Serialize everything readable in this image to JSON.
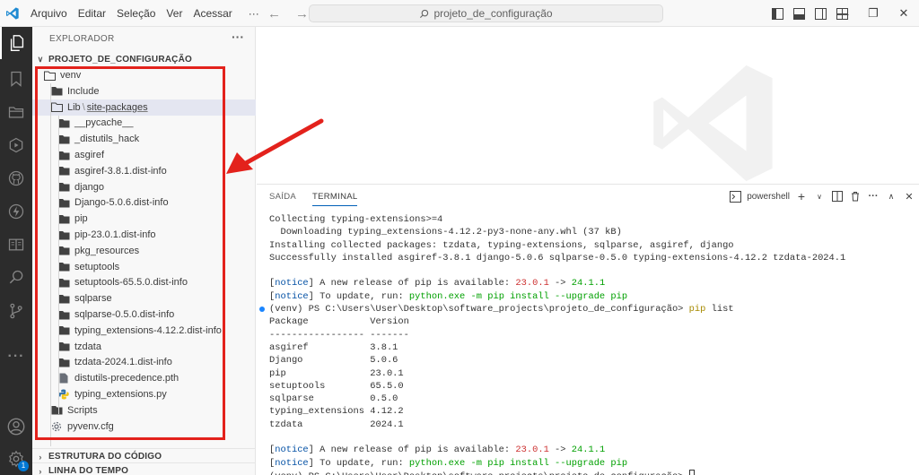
{
  "titlebar": {
    "menu": [
      "Arquivo",
      "Editar",
      "Seleção",
      "Ver",
      "Acessar",
      "···"
    ],
    "search": "projeto_de_configuração"
  },
  "sidebar": {
    "title": "EXPLORADOR",
    "more": "···",
    "project_section": "PROJETO_DE_CONFIGURAÇÃO",
    "tree": [
      {
        "label": "venv",
        "type": "folder-open",
        "depth": 0
      },
      {
        "label": "Include",
        "type": "folder",
        "depth": 1
      },
      {
        "label": "Lib",
        "extra": "site-packages",
        "type": "folder-open",
        "depth": 1,
        "selected": true
      },
      {
        "label": "__pycache__",
        "type": "folder",
        "depth": 2
      },
      {
        "label": "_distutils_hack",
        "type": "folder",
        "depth": 2
      },
      {
        "label": "asgiref",
        "type": "folder",
        "depth": 2
      },
      {
        "label": "asgiref-3.8.1.dist-info",
        "type": "folder",
        "depth": 2
      },
      {
        "label": "django",
        "type": "folder",
        "depth": 2
      },
      {
        "label": "Django-5.0.6.dist-info",
        "type": "folder",
        "depth": 2
      },
      {
        "label": "pip",
        "type": "folder",
        "depth": 2
      },
      {
        "label": "pip-23.0.1.dist-info",
        "type": "folder",
        "depth": 2
      },
      {
        "label": "pkg_resources",
        "type": "folder",
        "depth": 2
      },
      {
        "label": "setuptools",
        "type": "folder",
        "depth": 2
      },
      {
        "label": "setuptools-65.5.0.dist-info",
        "type": "folder",
        "depth": 2
      },
      {
        "label": "sqlparse",
        "type": "folder",
        "depth": 2
      },
      {
        "label": "sqlparse-0.5.0.dist-info",
        "type": "folder",
        "depth": 2
      },
      {
        "label": "typing_extensions-4.12.2.dist-info",
        "type": "folder",
        "depth": 2
      },
      {
        "label": "tzdata",
        "type": "folder",
        "depth": 2
      },
      {
        "label": "tzdata-2024.1.dist-info",
        "type": "folder",
        "depth": 2
      },
      {
        "label": "distutils-precedence.pth",
        "type": "file",
        "depth": 2
      },
      {
        "label": "typing_extensions.py",
        "type": "python",
        "depth": 2
      },
      {
        "label": "Scripts",
        "type": "folder",
        "depth": 1
      },
      {
        "label": "pyvenv.cfg",
        "type": "config",
        "depth": 1
      }
    ],
    "outline_section": "ESTRUTURA DO CÓDIGO",
    "timeline_section": "LINHA DO TEMPO"
  },
  "activity": {
    "badge_count": "1"
  },
  "panel": {
    "tabs": [
      "SAÍDA",
      "TERMINAL"
    ],
    "active_tab": "TERMINAL",
    "shell": "powershell",
    "terminal_lines": [
      [
        {
          "t": "Collecting typing-extensions>=4"
        }
      ],
      [
        {
          "t": "  Downloading typing_extensions-4.12.2-py3-none-any.whl (37 kB)"
        }
      ],
      [
        {
          "t": "Installing collected packages: tzdata, typing-extensions, sqlparse, asgiref, django"
        }
      ],
      [
        {
          "t": "Successfully installed asgiref-3.8.1 django-5.0.6 sqlparse-0.5.0 typing-extensions-4.12.2 tzdata-2024.1"
        }
      ],
      [
        {
          "t": ""
        }
      ],
      [
        {
          "t": "[",
          "c": ""
        },
        {
          "t": "notice",
          "c": "blue"
        },
        {
          "t": "] A new release of pip is available: "
        },
        {
          "t": "23.0.1",
          "c": "red"
        },
        {
          "t": " -> "
        },
        {
          "t": "24.1.1",
          "c": "green"
        }
      ],
      [
        {
          "t": "[",
          "c": ""
        },
        {
          "t": "notice",
          "c": "blue"
        },
        {
          "t": "] To update, run: "
        },
        {
          "t": "python.exe -m pip install --upgrade pip",
          "c": "green"
        }
      ],
      [
        {
          "t": "(venv) PS C:\\Users\\User\\Desktop\\software_projects\\projeto_de_configuração> "
        },
        {
          "t": "pip",
          "c": "ylw"
        },
        {
          "t": " list"
        }
      ],
      [
        {
          "t": "Package           Version"
        }
      ],
      [
        {
          "t": "----------------- -------"
        }
      ],
      [
        {
          "t": "asgiref           3.8.1"
        }
      ],
      [
        {
          "t": "Django            5.0.6"
        }
      ],
      [
        {
          "t": "pip               23.0.1"
        }
      ],
      [
        {
          "t": "setuptools        65.5.0"
        }
      ],
      [
        {
          "t": "sqlparse          0.5.0"
        }
      ],
      [
        {
          "t": "typing_extensions 4.12.2"
        }
      ],
      [
        {
          "t": "tzdata            2024.1"
        }
      ],
      [
        {
          "t": ""
        }
      ],
      [
        {
          "t": "[",
          "c": ""
        },
        {
          "t": "notice",
          "c": "blue"
        },
        {
          "t": "] A new release of pip is available: "
        },
        {
          "t": "23.0.1",
          "c": "red"
        },
        {
          "t": " -> "
        },
        {
          "t": "24.1.1",
          "c": "green"
        }
      ],
      [
        {
          "t": "[",
          "c": ""
        },
        {
          "t": "notice",
          "c": "blue"
        },
        {
          "t": "] To update, run: "
        },
        {
          "t": "python.exe -m pip install --upgrade pip",
          "c": "green"
        }
      ],
      [
        {
          "t": "(venv) PS C:\\Users\\User\\Desktop\\software_projects\\projeto_de_configuração> "
        }
      ]
    ]
  },
  "colors": {
    "annotation": "#e3221c",
    "accent": "#005fb8"
  }
}
